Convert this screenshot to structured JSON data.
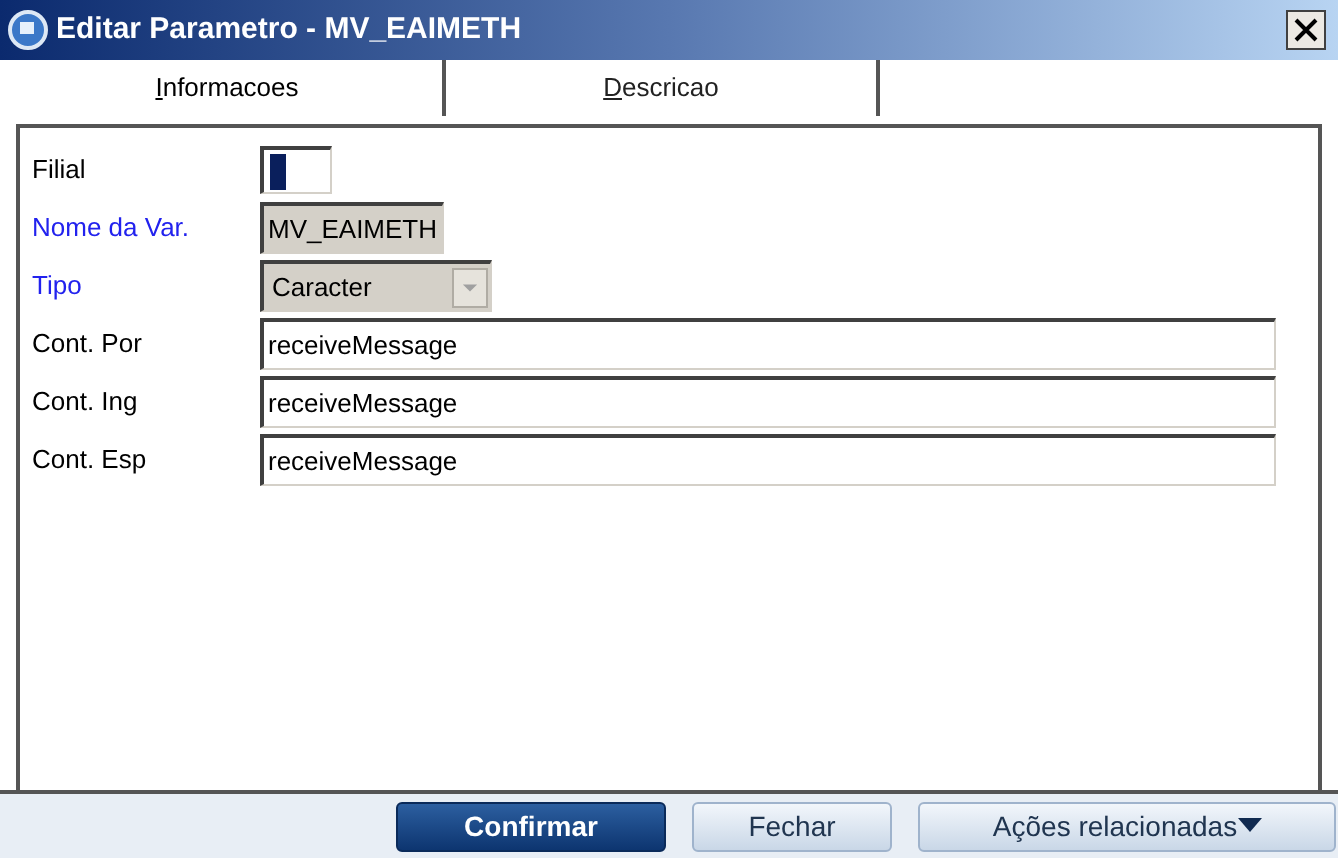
{
  "window": {
    "title": "Editar Parametro - MV_EAIMETH"
  },
  "tabs": [
    {
      "label": "Informacoes",
      "selected": true
    },
    {
      "label": "Descricao",
      "selected": false
    }
  ],
  "fields": [
    {
      "kind": "caret",
      "label": "Filial",
      "required": false
    },
    {
      "kind": "readonly",
      "label": "Nome da Var.",
      "required": true,
      "value": "MV_EAIMETH"
    },
    {
      "kind": "combo",
      "label": "Tipo",
      "required": true,
      "value": "Caracter"
    },
    {
      "kind": "text",
      "label": "Cont. Por",
      "required": false,
      "value": "receiveMessage"
    },
    {
      "kind": "text",
      "label": "Cont. Ing",
      "required": false,
      "value": "receiveMessage"
    },
    {
      "kind": "text",
      "label": "Cont. Esp",
      "required": false,
      "value": "receiveMessage"
    }
  ],
  "buttons": [
    {
      "label": "Confirmar",
      "kind": "primary"
    },
    {
      "label": "Fechar",
      "kind": "secondary"
    },
    {
      "label": "Ações relacionadas",
      "kind": "menu"
    }
  ]
}
